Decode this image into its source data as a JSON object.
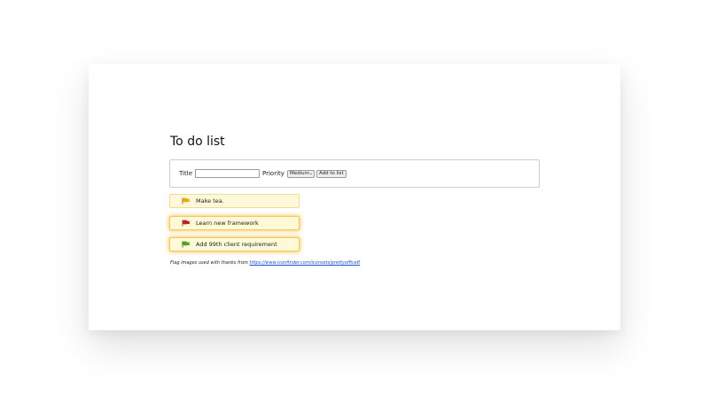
{
  "page": {
    "title": "To do list"
  },
  "form": {
    "title_label": "Title",
    "title_value": "",
    "priority_label": "Priority",
    "priority_selected": "Medium",
    "add_button_label": "Add to list"
  },
  "todos": [
    {
      "text": "Make tea.",
      "flag_color": "#e0b010",
      "highlighted": false
    },
    {
      "text": "Learn new framework",
      "flag_color": "#c02020",
      "highlighted": true
    },
    {
      "text": "Add 99th client requirement",
      "flag_color": "#4aa820",
      "highlighted": true
    }
  ],
  "credit": {
    "text": "Flag images used with thanks from ",
    "link_text": "https://www.iconfinder.com/iconsets/prettyoffice8"
  }
}
